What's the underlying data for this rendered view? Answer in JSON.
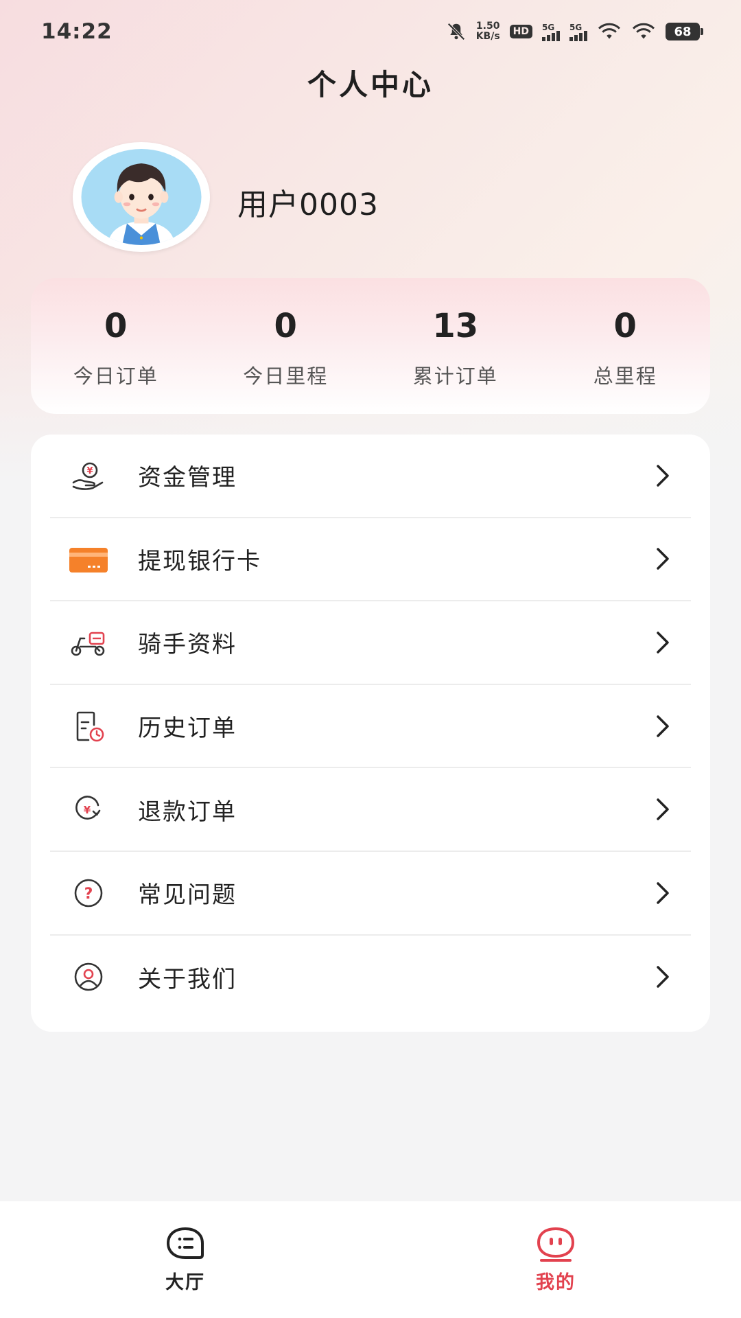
{
  "status_bar": {
    "time": "14:22",
    "net_speed_value": "1.50",
    "net_speed_unit": "KB/s",
    "hd_label": "HD",
    "signal1_label": "5G",
    "signal2_label": "5G",
    "battery": "68"
  },
  "page_title": "个人中心",
  "profile": {
    "username": "用户0003",
    "avatar_icon": "boy-avatar"
  },
  "stats": [
    {
      "value": "0",
      "label": "今日订单"
    },
    {
      "value": "0",
      "label": "今日里程"
    },
    {
      "value": "13",
      "label": "累计订单"
    },
    {
      "value": "0",
      "label": "总里程"
    }
  ],
  "menu": [
    {
      "label": "资金管理",
      "icon": "money-hand-icon"
    },
    {
      "label": "提现银行卡",
      "icon": "bank-card-icon"
    },
    {
      "label": "骑手资料",
      "icon": "scooter-icon"
    },
    {
      "label": "历史订单",
      "icon": "history-order-icon"
    },
    {
      "label": "退款订单",
      "icon": "refund-icon"
    },
    {
      "label": "常见问题",
      "icon": "question-icon"
    },
    {
      "label": "关于我们",
      "icon": "user-circle-icon"
    }
  ],
  "bottom_nav": [
    {
      "label": "大厅",
      "icon": "hall-icon",
      "active": false
    },
    {
      "label": "我的",
      "icon": "mine-icon",
      "active": true
    }
  ],
  "colors": {
    "accent_red": "#e2424f",
    "card_orange": "#f5812a"
  }
}
